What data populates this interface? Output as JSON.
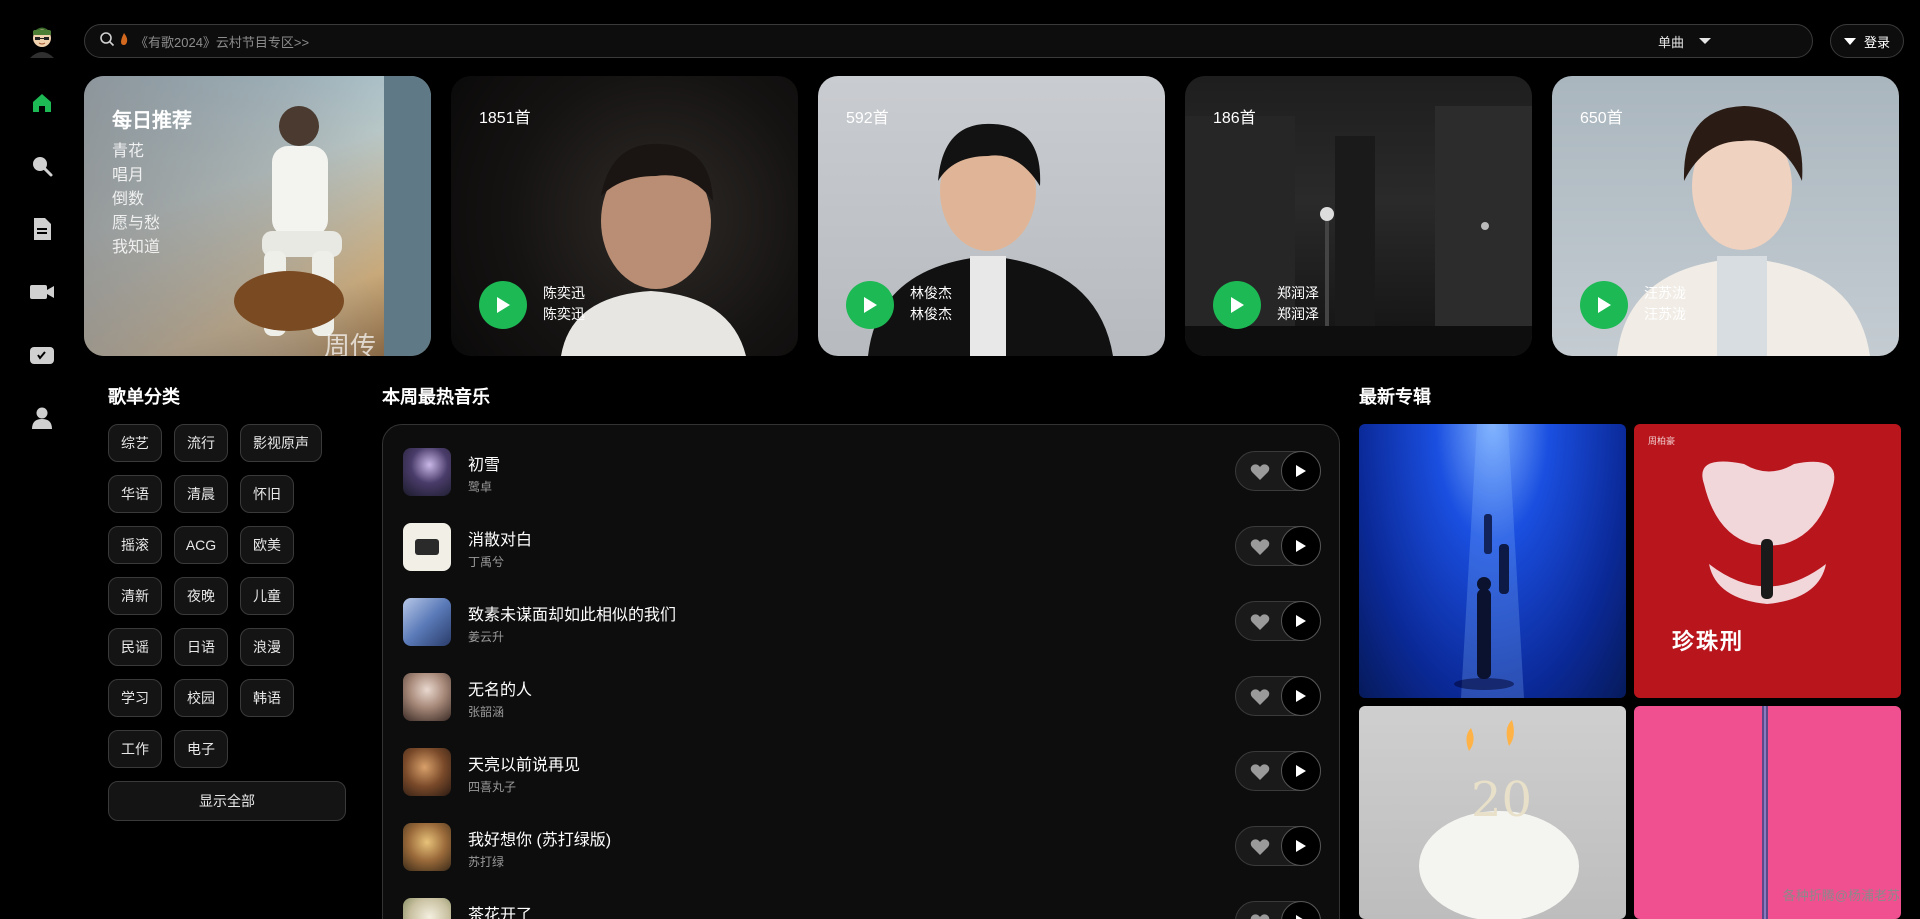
{
  "search": {
    "placeholder": "《有歌2024》云村节目专区>>",
    "type_label": "单曲"
  },
  "header": {
    "login_label": "登录"
  },
  "daily": {
    "title": "每日推荐",
    "songs": [
      "青花",
      "唱月",
      "倒数",
      "愿与愁",
      "我知道"
    ],
    "cover_text": "周传"
  },
  "artist_cards": [
    {
      "count": "1851首",
      "name1": "陈奕迅",
      "name2": "陈奕迅"
    },
    {
      "count": "592首",
      "name1": "林俊杰",
      "name2": "林俊杰"
    },
    {
      "count": "186首",
      "name1": "郑润泽",
      "name2": "郑润泽"
    },
    {
      "count": "650首",
      "name1": "汪苏泷",
      "name2": "汪苏泷"
    }
  ],
  "categories": {
    "title": "歌单分类",
    "tags": [
      "综艺",
      "流行",
      "影视原声",
      "华语",
      "清晨",
      "怀旧",
      "摇滚",
      "ACG",
      "欧美",
      "清新",
      "夜晚",
      "儿童",
      "民谣",
      "日语",
      "浪漫",
      "学习",
      "校园",
      "韩语",
      "工作",
      "电子"
    ],
    "show_all": "显示全部"
  },
  "hot": {
    "title": "本周最热音乐",
    "songs": [
      {
        "title": "初雪",
        "artist": "鹭卓"
      },
      {
        "title": "消散对白",
        "artist": "丁禹兮"
      },
      {
        "title": "致素未谋面却如此相似的我们",
        "artist": "姜云升"
      },
      {
        "title": "无名的人",
        "artist": "张韶涵"
      },
      {
        "title": "天亮以前说再见",
        "artist": "四喜丸子"
      },
      {
        "title": "我好想你 (苏打绿版)",
        "artist": "苏打绿"
      },
      {
        "title": "茶花开了",
        "artist": ""
      }
    ]
  },
  "albums": {
    "title": "最新专辑",
    "items": [
      {
        "text": ""
      },
      {
        "text": "珍珠刑",
        "small": "周柏豪"
      },
      {
        "text": ""
      },
      {
        "text": ""
      }
    ]
  },
  "watermark": "各种折腾@杨浦老苏",
  "colors": {
    "accent": "#1db954",
    "background": "#000000"
  }
}
